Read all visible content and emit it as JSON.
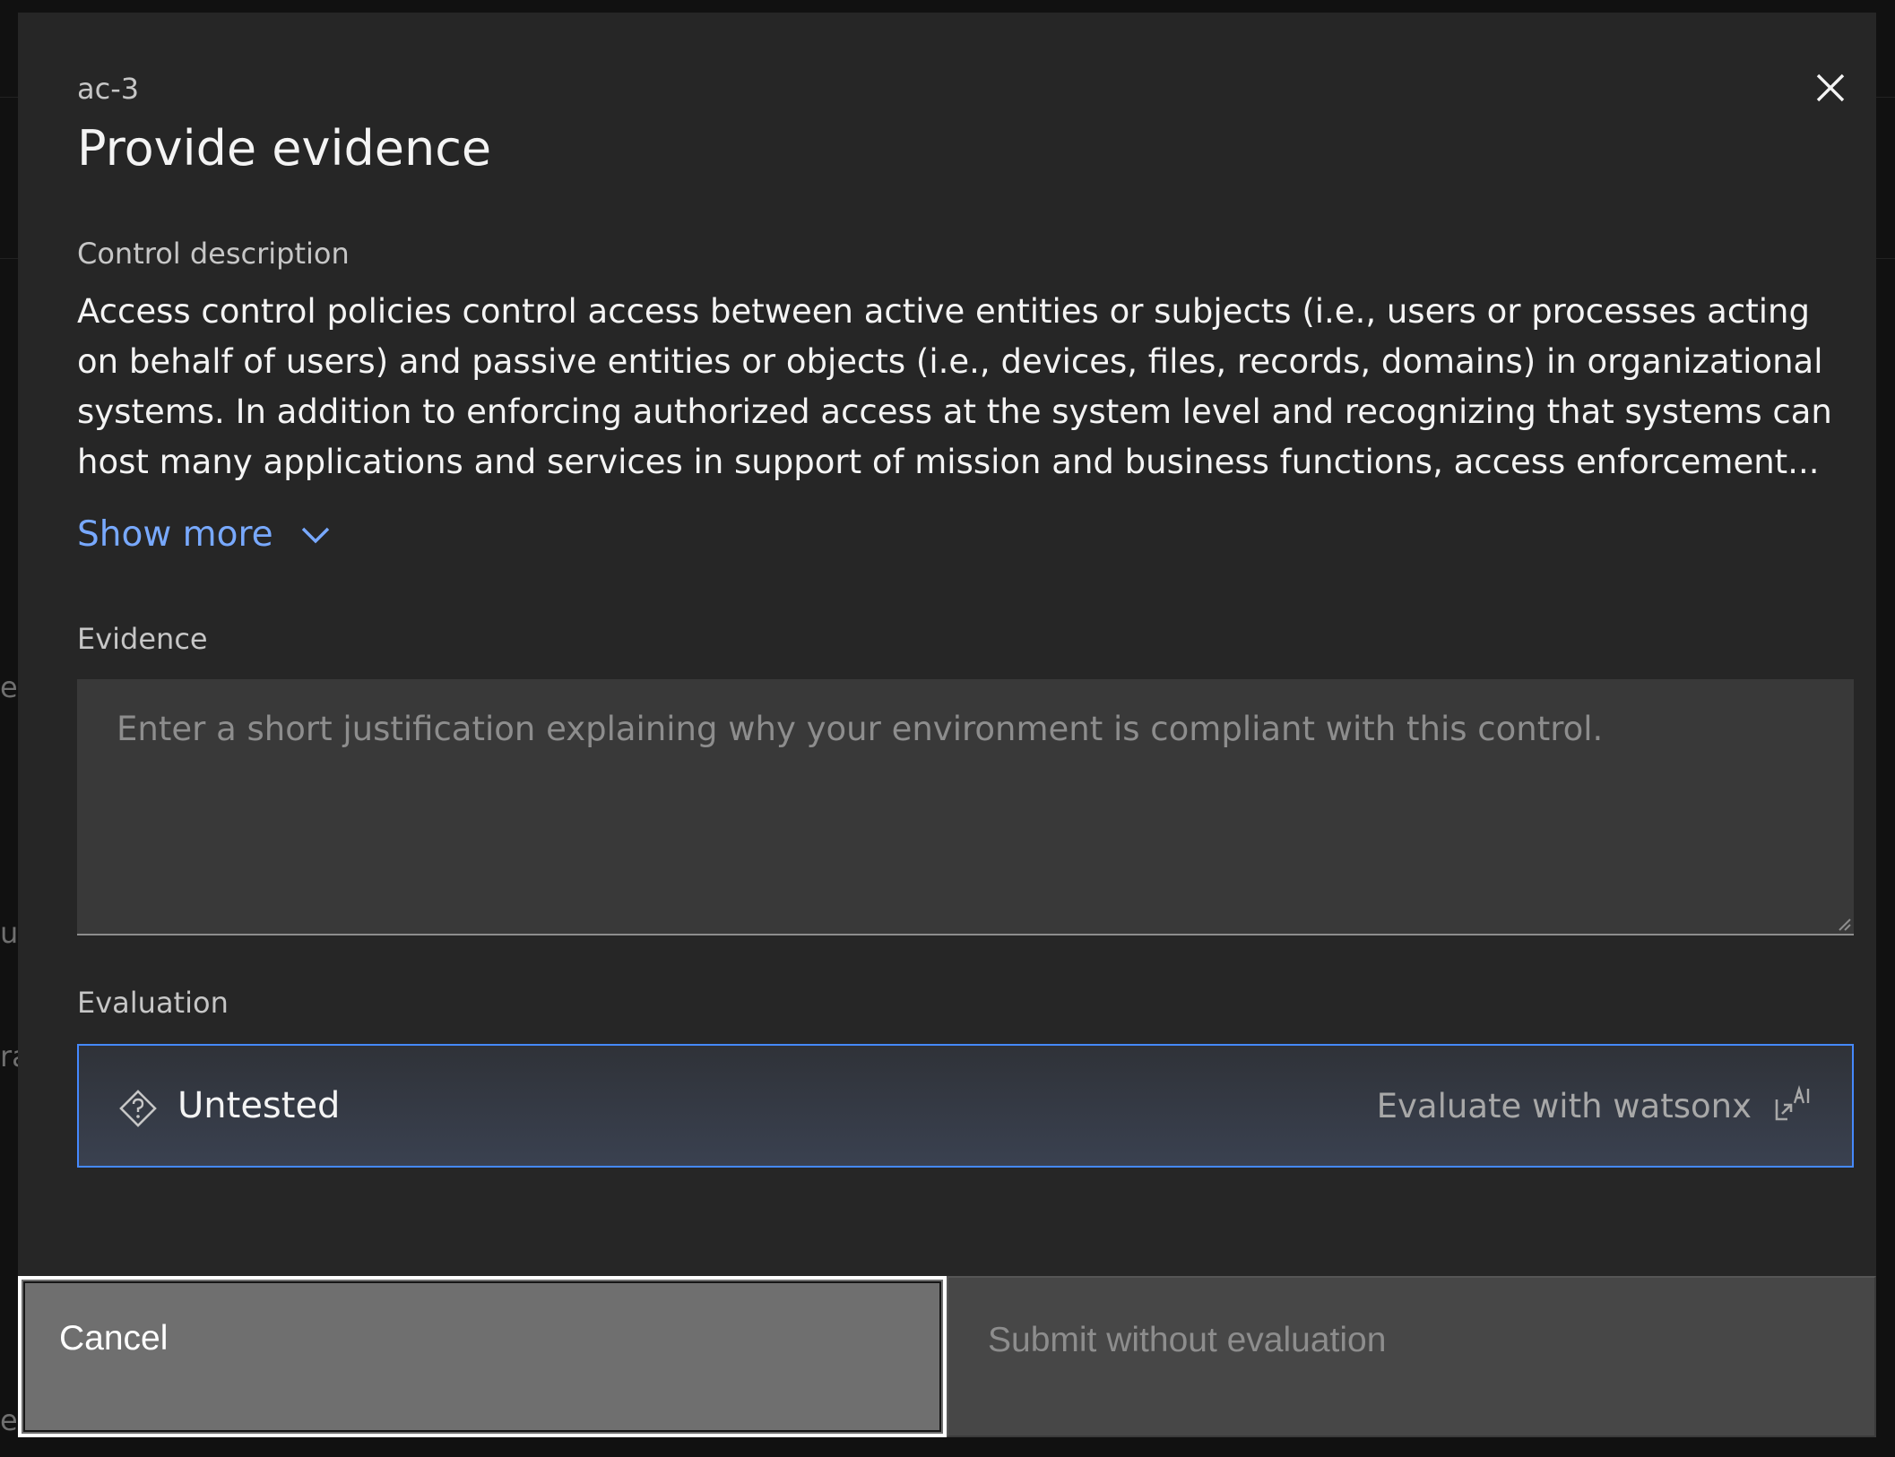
{
  "modal": {
    "control_id": "ac-3",
    "title": "Provide evidence",
    "control_description_label": "Control description",
    "control_description": "Access control policies control access between active entities or subjects (i.e., users or processes acting on behalf of users) and passive entities or objects (i.e., devices, files, records, domains) in organizational systems. In addition to enforcing authorized access at the system level and recognizing that systems can host many applications and services in support of mission and business functions, access enforcement...",
    "show_more_label": "Show more",
    "evidence_label": "Evidence",
    "evidence_value": "",
    "evidence_placeholder": "Enter a short justification explaining why your environment is compliant with this control.",
    "evaluation_label": "Evaluation",
    "evaluation_status": "Untested",
    "evaluate_ai_label": "Evaluate with watsonx",
    "cancel_label": "Cancel",
    "submit_label": "Submit without evaluation"
  },
  "icons": {
    "close": "close-icon",
    "show_more": "chevron-down-icon",
    "untested": "untested-diamond-icon",
    "ai": "ai-launch-icon"
  },
  "colors": {
    "modal_bg": "#262626",
    "link": "#78a9ff",
    "focus": "#4589ff",
    "field_bg": "#393939"
  }
}
